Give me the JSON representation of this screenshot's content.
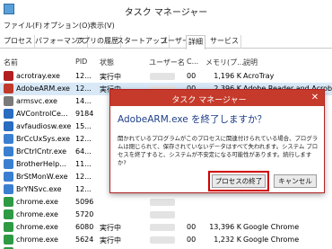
{
  "window": {
    "title": "タスク マネージャー"
  },
  "menu": [
    "ファイル(F)",
    "オプション(O)",
    "表示(V)"
  ],
  "tabs": [
    "プロセス",
    "パフォーマンス",
    "アプリの履歴",
    "スタートアップ",
    "ユーザー",
    "詳細",
    "サービス"
  ],
  "active_tab": "詳細",
  "columns": [
    "名前",
    "PID",
    "状態",
    "ユーザー名",
    "C...",
    "メモリ(プ...",
    "説明"
  ],
  "rows": [
    {
      "name": "acrotray.exe",
      "pid": "12...",
      "status": "実行中",
      "cpu": "00",
      "mem": "1,196 K",
      "desc": "AcroTray",
      "icon_color": "#b21f1f"
    },
    {
      "name": "AdobeARM.exe",
      "pid": "12...",
      "status": "実行中",
      "cpu": "00",
      "mem": "2,396 K",
      "desc": "Adobe Reader and Acrob",
      "icon_color": "#c0392b"
    },
    {
      "name": "armsvc.exe",
      "pid": "14...",
      "status": "",
      "cpu": "",
      "mem": "",
      "desc": "",
      "icon_color": "#7a7a7a"
    },
    {
      "name": "AVControlCe...",
      "pid": "9184",
      "status": "",
      "cpu": "",
      "mem": "",
      "desc": "",
      "icon_color": "#2a6cc0"
    },
    {
      "name": "avfaudiosw.exe",
      "pid": "15...",
      "status": "",
      "cpu": "",
      "mem": "",
      "desc": "",
      "icon_color": "#2a6cc0"
    },
    {
      "name": "BrCcUxSys.exe",
      "pid": "12...",
      "status": "",
      "cpu": "",
      "mem": "",
      "desc": "",
      "icon_color": "#3b7fd1"
    },
    {
      "name": "BrCtrlCntr.exe",
      "pid": "64...",
      "status": "",
      "cpu": "",
      "mem": "",
      "desc": "",
      "icon_color": "#3b7fd1"
    },
    {
      "name": "BrotherHelp...",
      "pid": "11...",
      "status": "",
      "cpu": "",
      "mem": "",
      "desc": "",
      "icon_color": "#3b7fd1"
    },
    {
      "name": "BrStMonW.exe",
      "pid": "12...",
      "status": "",
      "cpu": "",
      "mem": "",
      "desc": "",
      "icon_color": "#3b7fd1"
    },
    {
      "name": "BrYNSvc.exe",
      "pid": "12...",
      "status": "",
      "cpu": "",
      "mem": "",
      "desc": "",
      "icon_color": "#3b7fd1"
    },
    {
      "name": "chrome.exe",
      "pid": "5096",
      "status": "",
      "cpu": "",
      "mem": "",
      "desc": "",
      "icon_color": "#2e9a44"
    },
    {
      "name": "chrome.exe",
      "pid": "5720",
      "status": "",
      "cpu": "",
      "mem": "",
      "desc": "",
      "icon_color": "#2e9a44"
    },
    {
      "name": "chrome.exe",
      "pid": "6080",
      "status": "実行中",
      "cpu": "00",
      "mem": "13,396 K",
      "desc": "Google Chrome",
      "icon_color": "#2e9a44"
    },
    {
      "name": "chrome.exe",
      "pid": "5624",
      "status": "実行中",
      "cpu": "00",
      "mem": "1,232 K",
      "desc": "Google Chrome",
      "icon_color": "#2e9a44"
    },
    {
      "name": "chrome.exe",
      "pid": "12...",
      "status": "実行中",
      "cpu": "00",
      "mem": "31,148 K",
      "desc": "Google Chrome",
      "icon_color": "#2e9a44"
    }
  ],
  "dialog": {
    "title": "タスク マネージャー",
    "close": "✕",
    "heading": "AdobeARM.exe を終了しますか？",
    "body": "開かれているプログラムがこのプロセスに関連付けられている場合、プログラムは閉じられて、保存されていないデータはすべて失われます。システム プロセスを終了すると、システムが不安定になる可能性があります。続行しますか?",
    "end_button": "プロセスの終了",
    "cancel_button": "キャンセル",
    "accent": "#c53a2a"
  }
}
